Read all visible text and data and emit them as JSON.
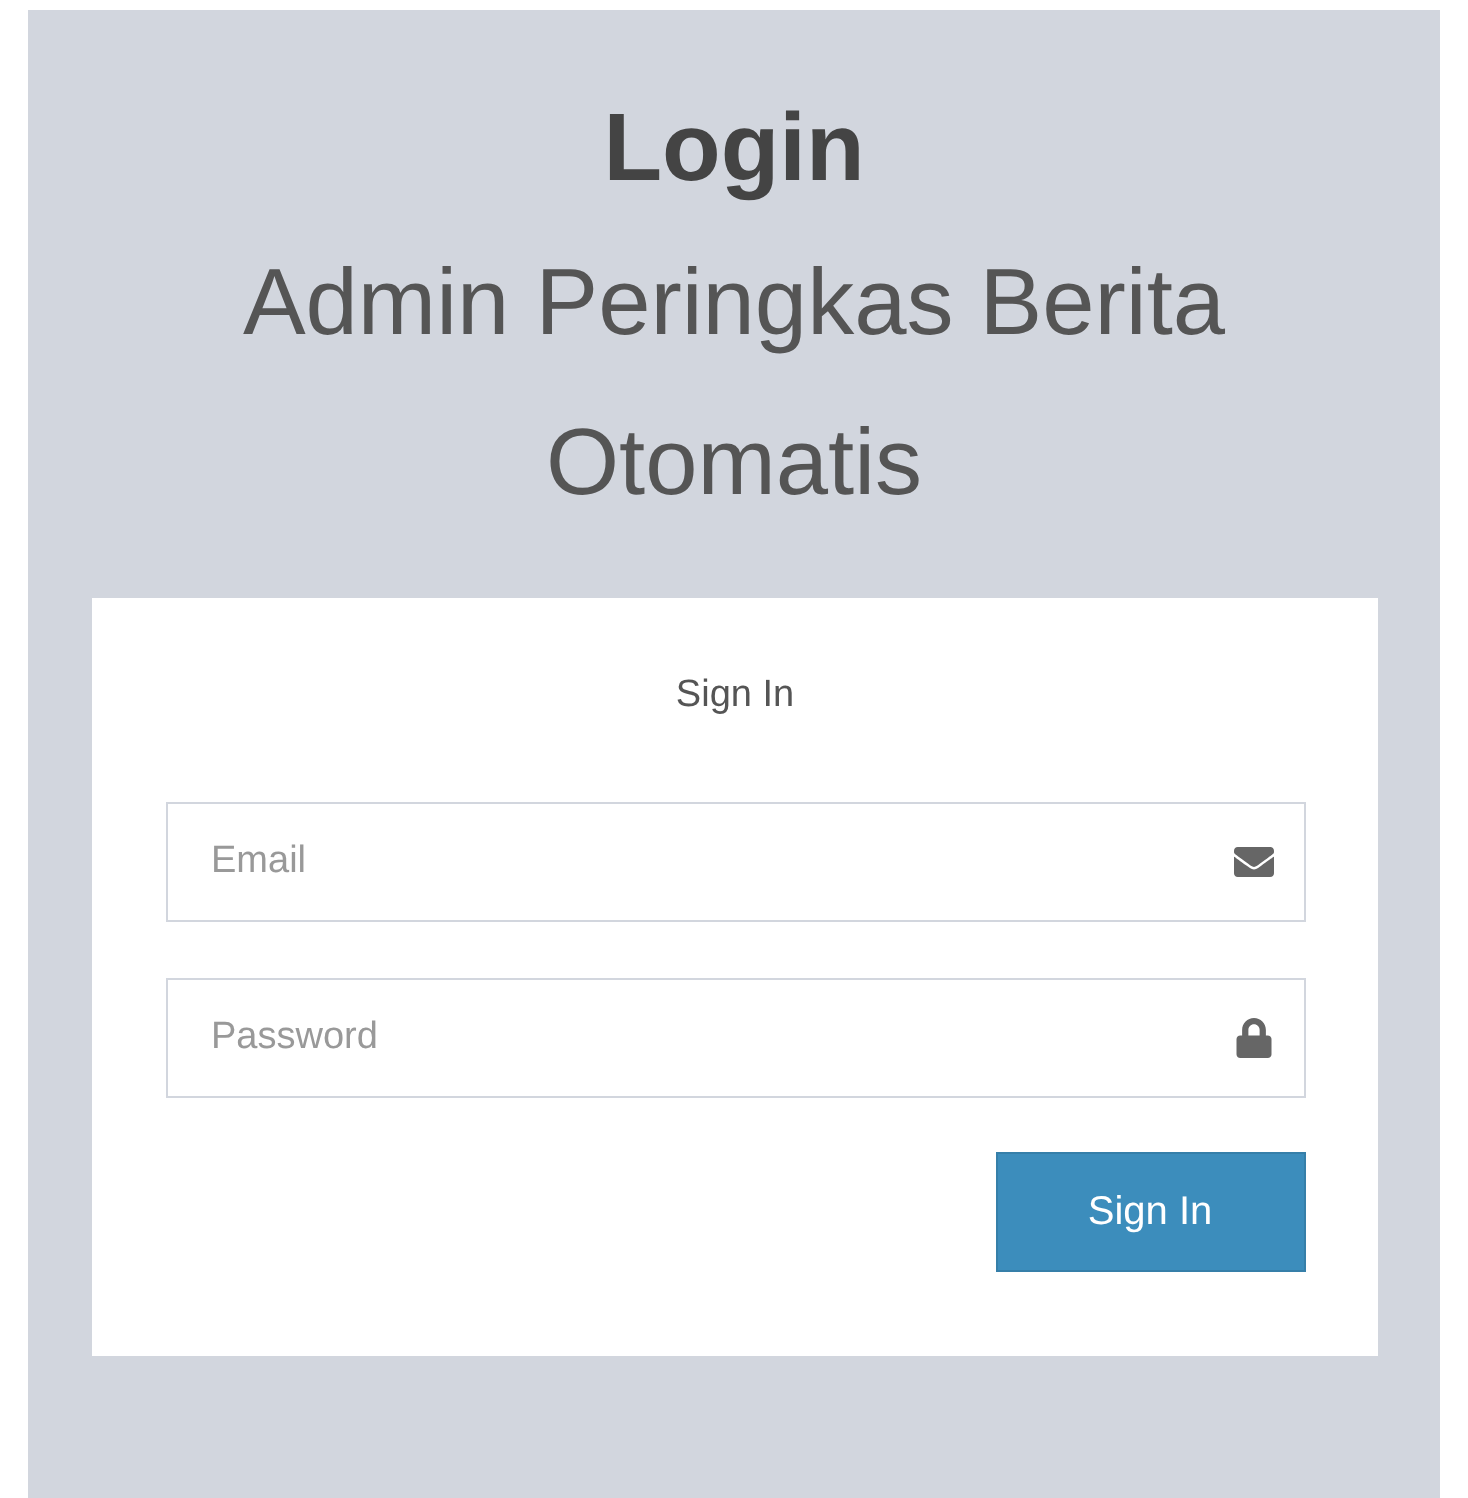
{
  "header": {
    "title": "Login",
    "subtitle": "Admin Peringkas Berita Otomatis"
  },
  "card": {
    "heading": "Sign In",
    "fields": [
      {
        "kind": "email",
        "placeholder": "Email"
      },
      {
        "kind": "password",
        "placeholder": "Password"
      }
    ],
    "button": "Sign In"
  }
}
